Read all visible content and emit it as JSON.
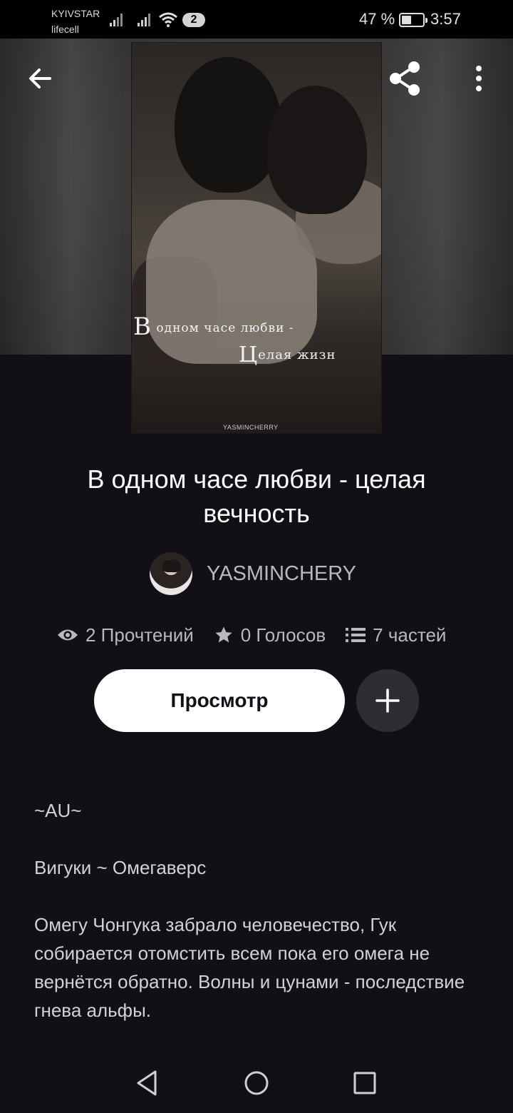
{
  "status_bar": {
    "carrier1": "KYIVSTAR",
    "carrier2": "lifecell",
    "sim_count": "2",
    "battery_percent": "47 %",
    "battery_level": 0.47,
    "time": "3:57"
  },
  "toolbar": {
    "back_icon": "arrow-left-icon",
    "share_icon": "share-icon",
    "more_icon": "more-vertical-icon"
  },
  "cover": {
    "line1_first": "В",
    "line1_rest": " одном часе любви -",
    "line2_first": "Ц",
    "line2_rest": "елая жизн",
    "credit": "YASMINCHERRY"
  },
  "story": {
    "title": "В одном часе любви - целая вечность",
    "author": "YASMINCHERY"
  },
  "stats": {
    "reads": "2 Прочтений",
    "votes": "0 Голосов",
    "parts": "7 частей"
  },
  "actions": {
    "read_label": "Просмотр",
    "add_icon": "plus-icon"
  },
  "description": {
    "p1": "~AU~",
    "p2": "Вигуки ~ Омегаверс",
    "p3": "Омегу Чонгука забрало человечество, Гук собирается отомстить всем пока его омега не вернётся обратно. Волны и цунами - последствие гнева альфы."
  },
  "colors": {
    "background": "#121016",
    "primary_button": "#ffffff",
    "secondary_button": "#2e2d32",
    "muted_text": "#b9b9bb"
  }
}
